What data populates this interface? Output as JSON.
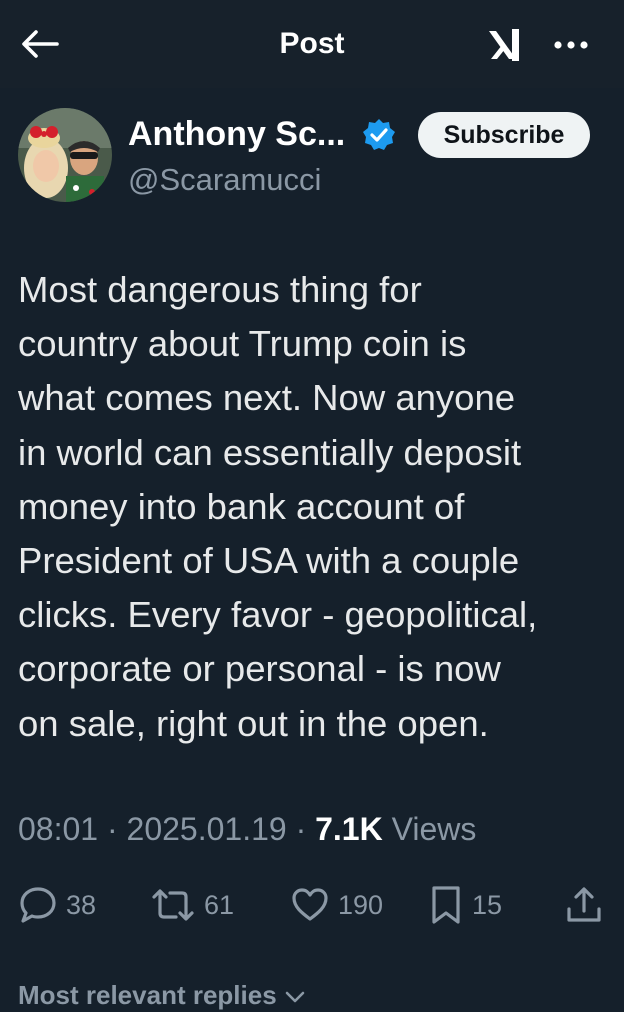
{
  "header": {
    "title": "Post"
  },
  "author": {
    "display_name": "Anthony Sc...",
    "handle": "@Scaramucci",
    "subscribe_label": "Subscribe"
  },
  "tweet": {
    "lines": [
      "Most dangerous thing for",
      "country about Trump coin is",
      "what comes next. Now anyone",
      "in world can essentially deposit",
      "money into bank account of",
      "President of USA with a couple",
      "clicks. Every favor - geopolitical,",
      "corporate or personal - is now",
      "on sale, right out in the open."
    ]
  },
  "meta": {
    "time": "08:01",
    "separator": " · ",
    "date": "2025.01.19",
    "views_count": "7.1K",
    "views_label": "Views"
  },
  "actions": {
    "replies": "38",
    "reposts": "61",
    "likes": "190",
    "bookmarks": "15"
  },
  "replies_sort": {
    "label": "Most relevant replies"
  },
  "icons": [
    "back-arrow-icon",
    "grok-icon",
    "more-icon",
    "verified-badge-icon",
    "reply-icon",
    "repost-icon",
    "like-icon",
    "bookmark-icon",
    "share-icon",
    "chevron-down-icon"
  ],
  "colors": {
    "background": "#15202b",
    "text": "#e7e9ea",
    "muted": "#8b98a5",
    "verified": "#1d9bf0"
  }
}
